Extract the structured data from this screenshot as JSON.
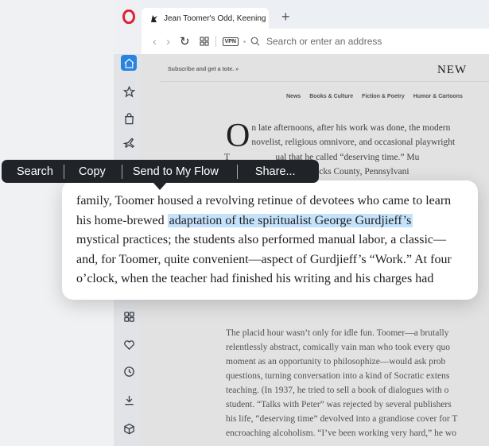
{
  "browser": {
    "tab_title": "Jean Toomer's Odd, Keening",
    "new_tab_symbol": "+",
    "address_placeholder": "Search or enter an address",
    "vpn_label": "VPN"
  },
  "sidebar": {
    "icons": [
      "home-icon",
      "star-icon",
      "bag-icon",
      "airplane-icon",
      "grid-icon",
      "heart-icon",
      "history-icon",
      "download-icon",
      "cube-icon"
    ]
  },
  "page": {
    "subscribe_text": "Subscribe and get a tote. »",
    "masthead": "NEW",
    "nav": [
      "News",
      "Books & Culture",
      "Fiction & Poetry",
      "Humor & Cartoons"
    ],
    "dropcap": "O",
    "para1_lines": [
      "n late afternoons, after his work was done, the modern",
      "novelist, religious omnivore, and occasional playwright",
      "T                    ual that he called “deserving time.” Mu",
      "                  us spent in Bucks County, Pennsylvani"
    ],
    "para2_lines": [
      "The placid hour wasn’t only for idle fun. Toomer—a brutally",
      "relentlessly abstract, comically vain man who took every quo",
      "moment as an opportunity to philosophize—would ask prob",
      "questions, turning conversation into a kind of Socratic extens",
      "teaching. (In 1937, he tried to sell a book of dialogues with o",
      "student. “Talks with Peter” was rejected by several publishers",
      "his life, “deserving time” devolved into a grandiose cover for T",
      "encroaching alcoholism. “I’ve been working very hard,” he wo"
    ]
  },
  "magnifier": {
    "line1": "family, Toomer housed a revolving retinue of devotees who came to learn",
    "line2_before": "his home-brewed ",
    "line2_highlight": "adaptation of the spiritualist George Gurdjieff’s",
    "line3": "mystical practices; the students also performed manual labor, a classic—",
    "line4": "and, for Toomer, quite convenient—aspect of Gurdjieff’s “Work.” At four",
    "line5": "o’clock, when the teacher had finished his writing and his charges had"
  },
  "context_menu": {
    "search": "Search",
    "copy": "Copy",
    "send": "Send to My Flow",
    "share": "Share..."
  },
  "colors": {
    "accent": "#2a8cf0",
    "highlight": "#c5e2fb",
    "menu_bg": "#202328",
    "opera_red": "#e0212e"
  }
}
